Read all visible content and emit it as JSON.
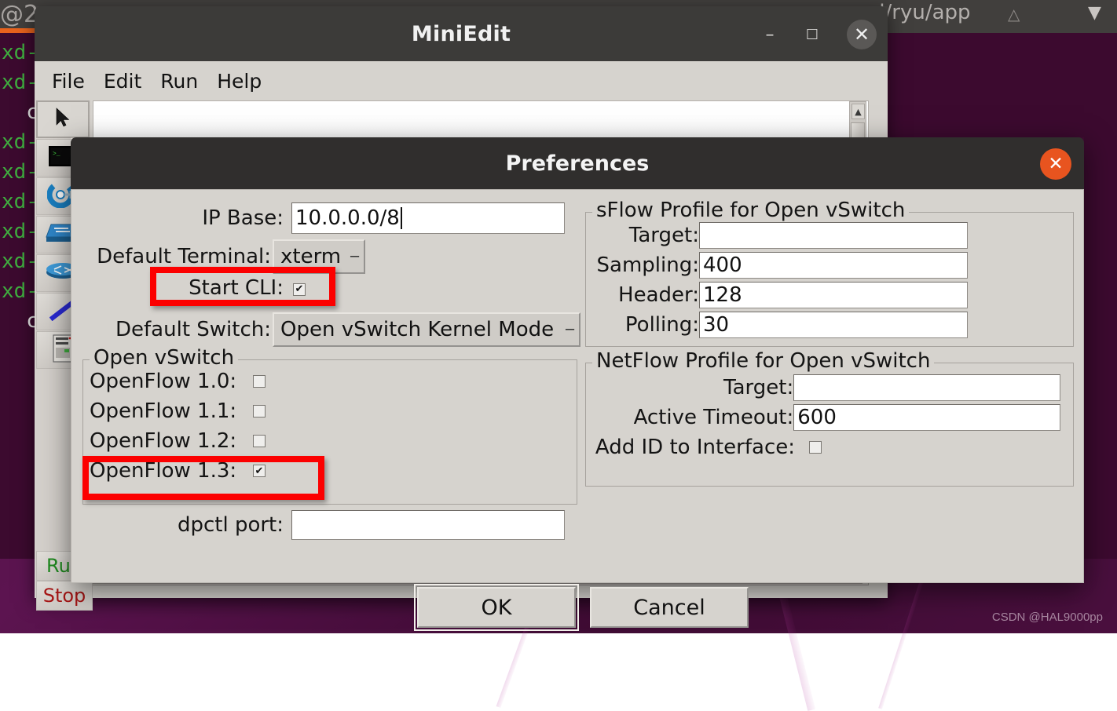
{
  "desktop": {
    "watermark": "CSDN @HAL9000pp"
  },
  "background_terminal": {
    "title_left": "@2",
    "title_right": "d/ryu/app",
    "caret_up_icon": "chevron-up-icon",
    "caret_down_icon": "chevron-down-icon",
    "lines": [
      {
        "green": "xd-",
        "white": ""
      },
      {
        "green": "xd-",
        "white": ""
      },
      {
        "green": "",
        "white": "co"
      },
      {
        "green": "xd-",
        "white": ""
      },
      {
        "green": "xd-",
        "white": ""
      },
      {
        "green": "xd-",
        "white": ""
      },
      {
        "green": "xd-",
        "white": ""
      },
      {
        "green": "xd-",
        "white": ""
      },
      {
        "green": "xd-",
        "white": ""
      },
      {
        "green": "",
        "white": "co"
      }
    ]
  },
  "miniedit": {
    "title": "MiniEdit",
    "window_controls": {
      "minimize": "–",
      "maximize": "☐",
      "close": "✕"
    },
    "menus": [
      "File",
      "Edit",
      "Run",
      "Help"
    ],
    "toolbar": [
      {
        "name": "select-tool",
        "icon": "cursor-arrow-icon"
      },
      {
        "name": "host-tool",
        "icon": "terminal-icon"
      },
      {
        "name": "controller-tool",
        "icon": "controller-icon"
      },
      {
        "name": "switch-tool",
        "icon": "switch-icon"
      },
      {
        "name": "legacy-switch-tool",
        "icon": "legacy-switch-icon"
      },
      {
        "name": "link-tool",
        "icon": "link-icon"
      },
      {
        "name": "legacy-router-tool",
        "icon": "legacy-router-icon"
      }
    ],
    "run_button": "Run",
    "stop_button": "Stop"
  },
  "preferences": {
    "title": "Preferences",
    "close_icon": "close-icon",
    "left": {
      "ip_base_label": "IP Base:",
      "ip_base_value": "10.0.0.0/8",
      "default_terminal_label": "Default Terminal:",
      "default_terminal_value": "xterm",
      "start_cli_label": "Start CLI:",
      "start_cli_checked": true,
      "default_switch_label": "Default Switch:",
      "default_switch_value": "Open vSwitch Kernel Mode",
      "ovs_group_title": "Open vSwitch",
      "openflow": [
        {
          "label": "OpenFlow 1.0:",
          "checked": false
        },
        {
          "label": "OpenFlow 1.1:",
          "checked": false
        },
        {
          "label": "OpenFlow 1.2:",
          "checked": false
        },
        {
          "label": "OpenFlow 1.3:",
          "checked": true
        }
      ],
      "dpctl_label": "dpctl port:",
      "dpctl_value": ""
    },
    "right": {
      "sflow_group_title": "sFlow Profile for Open vSwitch",
      "sflow_fields": [
        {
          "label": "Target:",
          "value": ""
        },
        {
          "label": "Sampling:",
          "value": "400"
        },
        {
          "label": "Header:",
          "value": "128"
        },
        {
          "label": "Polling:",
          "value": "30"
        }
      ],
      "netflow_group_title": "NetFlow Profile for Open vSwitch",
      "netflow_fields": [
        {
          "label": "Target:",
          "value": ""
        },
        {
          "label": "Active Timeout:",
          "value": "600"
        }
      ],
      "netflow_addid_label": "Add ID to Interface:",
      "netflow_addid_checked": false
    },
    "buttons": {
      "ok": "OK",
      "cancel": "Cancel"
    },
    "highlight_color": "#fc0000"
  },
  "checkmark_glyph": "✔"
}
